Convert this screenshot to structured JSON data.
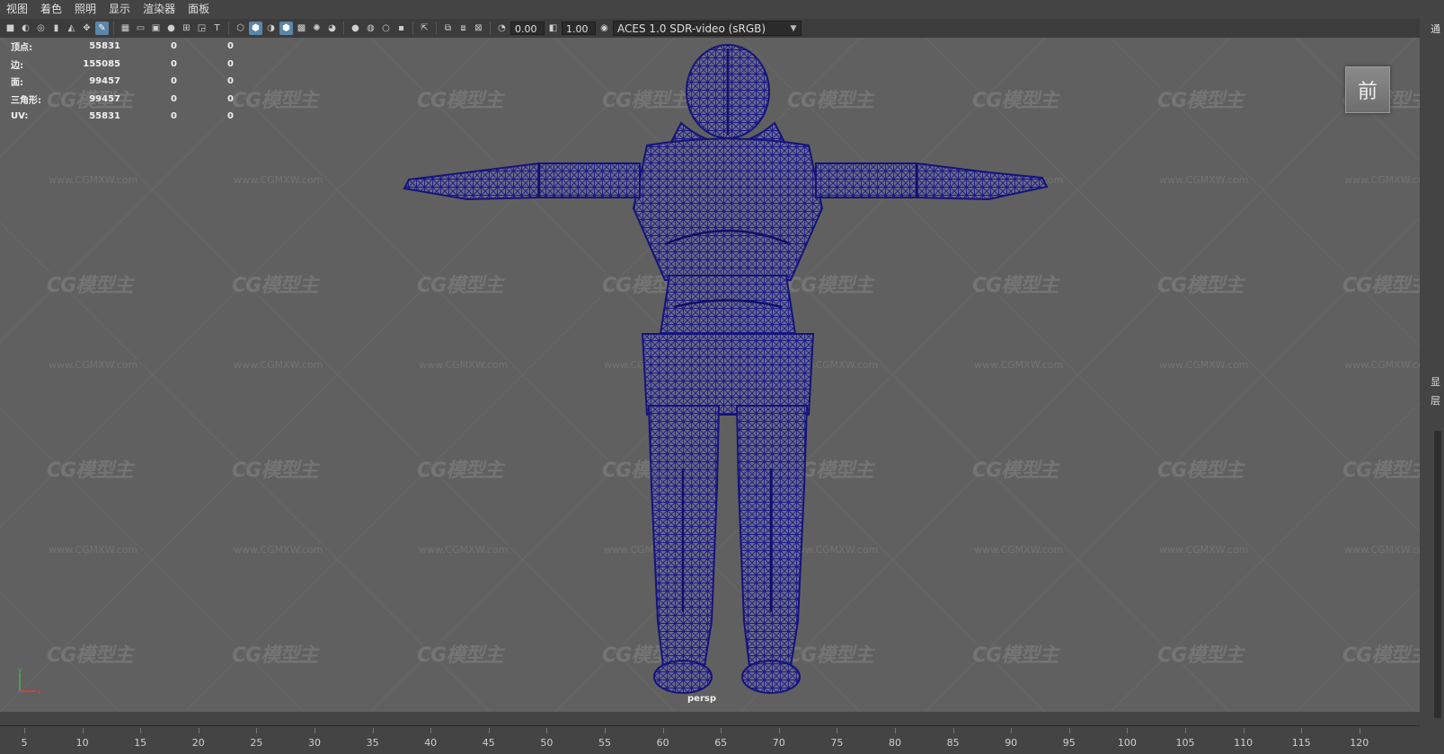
{
  "menu": [
    "视图",
    "着色",
    "照明",
    "显示",
    "渲染器",
    "面板"
  ],
  "toolbar": {
    "exposure_value": "0.00",
    "gamma_value": "1.00",
    "color_space": "ACES 1.0 SDR-video (sRGB)"
  },
  "hud": {
    "rows": [
      {
        "label": "顶点:",
        "value": "55831",
        "sel1": "0",
        "sel2": "0"
      },
      {
        "label": "边:",
        "value": "155085",
        "sel1": "0",
        "sel2": "0"
      },
      {
        "label": "面:",
        "value": "99457",
        "sel1": "0",
        "sel2": "0"
      },
      {
        "label": "三角形:",
        "value": "99457",
        "sel1": "0",
        "sel2": "0"
      },
      {
        "label": "UV:",
        "value": "55831",
        "sel1": "0",
        "sel2": "0"
      }
    ]
  },
  "view_cube": {
    "face_label": "前"
  },
  "camera_label": "persp",
  "axis": {
    "x": "x",
    "y": "y",
    "z": "z"
  },
  "right_panel": {
    "labels": [
      "通",
      "显",
      "层"
    ]
  },
  "timeline": {
    "ticks": [
      "5",
      "10",
      "15",
      "20",
      "25",
      "30",
      "35",
      "40",
      "45",
      "50",
      "55",
      "60",
      "65",
      "70",
      "75",
      "80",
      "85",
      "90",
      "95",
      "100",
      "105",
      "110",
      "115",
      "120"
    ]
  },
  "watermark": {
    "brand": "CG模型主",
    "url": "www.CGMXW.com"
  },
  "colors": {
    "wireframe": "#1a1a8c",
    "viewport_bg": "#606060"
  }
}
